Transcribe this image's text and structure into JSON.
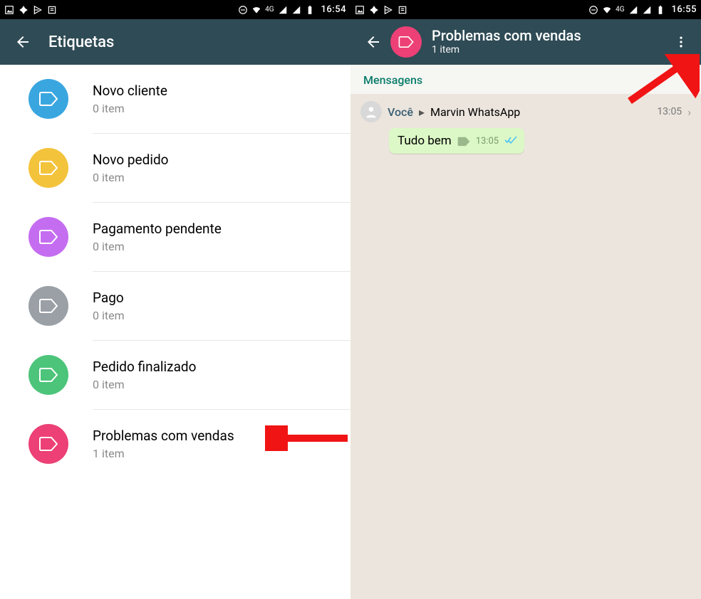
{
  "left": {
    "status": {
      "network_type": "4G",
      "time": "16:54"
    },
    "appbar": {
      "title": "Etiquetas"
    },
    "labels": [
      {
        "name": "Novo cliente",
        "count_text": "0 item",
        "color": "#3aa6e0"
      },
      {
        "name": "Novo pedido",
        "count_text": "0 item",
        "color": "#f3c33b"
      },
      {
        "name": "Pagamento pendente",
        "count_text": "0 item",
        "color": "#c56df0"
      },
      {
        "name": "Pago",
        "count_text": "0 item",
        "color": "#9aa0a6"
      },
      {
        "name": "Pedido finalizado",
        "count_text": "0 item",
        "color": "#4cc47a"
      },
      {
        "name": "Problemas com vendas",
        "count_text": "1 item",
        "color": "#ec4076"
      }
    ],
    "arrow_color": "#f01414"
  },
  "right": {
    "status": {
      "network_type": "4G",
      "time": "16:55"
    },
    "appbar": {
      "title": "Problemas com vendas",
      "subtitle": "1 item",
      "label_color": "#ec4076"
    },
    "section_header": "Mensagens",
    "message": {
      "from": "Você",
      "to": "Marvin WhatsApp",
      "row_time": "13:05",
      "bubble_text": "Tudo bem",
      "bubble_time": "13:05"
    },
    "arrow_color": "#f01414"
  }
}
